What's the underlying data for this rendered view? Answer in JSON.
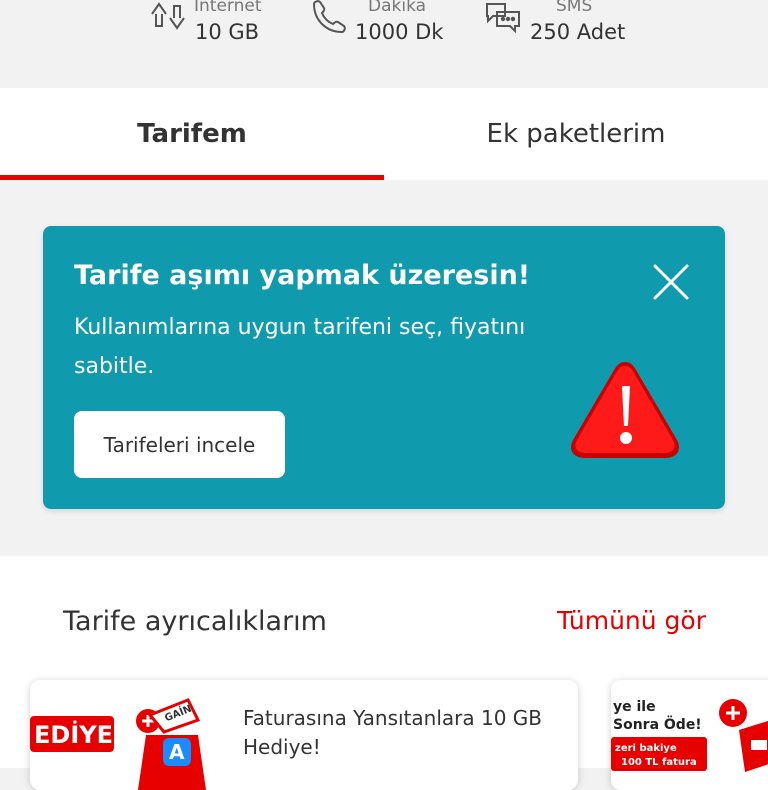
{
  "stats": [
    {
      "label": "İnternet",
      "value": "10 GB",
      "icon": "data-transfer-icon"
    },
    {
      "label": "Dakika",
      "value": "1000 Dk",
      "icon": "phone-icon"
    },
    {
      "label": "SMS",
      "value": "250 Adet",
      "icon": "chat-icon"
    }
  ],
  "tabs": [
    {
      "label": "Tarifem",
      "active": true
    },
    {
      "label": "Ek paketlerim",
      "active": false
    }
  ],
  "banner": {
    "title": "Tarife aşımı yapmak üzeresin!",
    "text": "Kullanımlarına uygun tarifeni seç, fiyatını sabitle.",
    "button_label": "Tarifeleri incele",
    "close_icon": "close-icon",
    "warning_icon": "warning-icon"
  },
  "benefits": {
    "title": "Tarife ayrıcalıklarım",
    "see_all": "Tümünü gör",
    "cards": [
      {
        "text": "Faturasına Yansıtanlara 10 GB Hediye!",
        "image_label": "EDİYE",
        "badge_text": "GAİN"
      },
      {
        "line1": "ye ile",
        "line2": "Sonra Öde!",
        "line3": "zeri bakiye",
        "line4": "100 TL fatura"
      }
    ]
  },
  "colors": {
    "accent": "#e60000",
    "banner": "#0f9aad",
    "background": "#f2f2f2"
  }
}
